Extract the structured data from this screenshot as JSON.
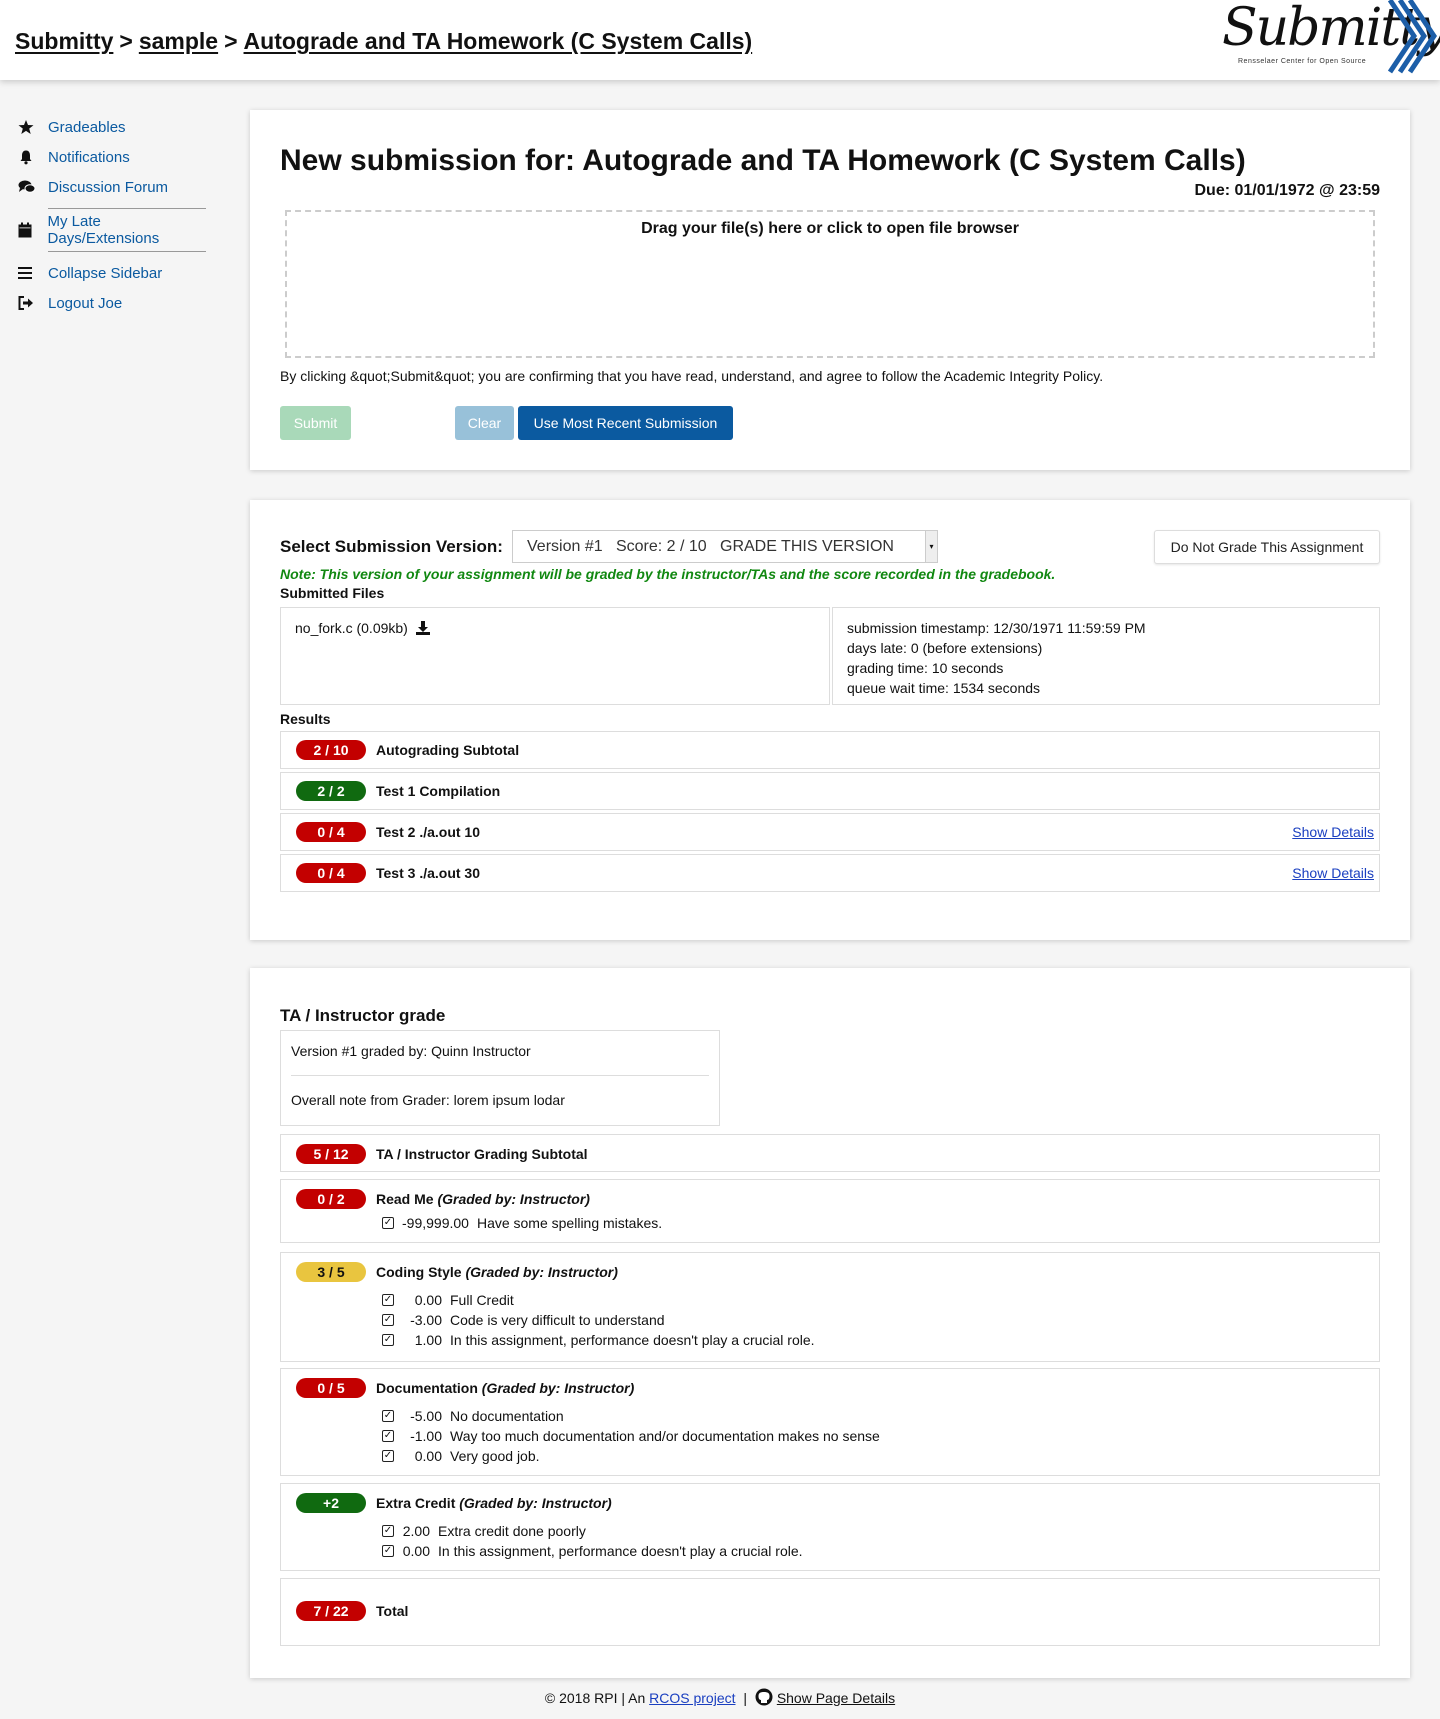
{
  "header": {
    "crumbs": [
      "Submitty",
      "sample",
      "Autograde and TA Homework (C System Calls)"
    ],
    "logo_text": "Submitty",
    "logo_sub": "Rensselaer Center for Open Source"
  },
  "sidebar": {
    "items": [
      {
        "label": "Gradeables",
        "icon": "star-icon"
      },
      {
        "label": "Notifications",
        "icon": "bell-icon"
      },
      {
        "label": "Discussion Forum",
        "icon": "comments-icon"
      },
      {
        "label": "My Late Days/Extensions",
        "icon": "calendar-icon"
      },
      {
        "label": "Collapse Sidebar",
        "icon": "bars-icon"
      },
      {
        "label": "Logout Joe",
        "icon": "logout-icon"
      }
    ]
  },
  "submission": {
    "title": "New submission for: Autograde and TA Homework (C System Calls)",
    "due": "Due: 01/01/1972 @ 23:59",
    "dropzone": "Drag your file(s) here or click to open file browser",
    "integrity": "By clicking &quot;Submit&quot; you are confirming that you have read, understand, and agree to follow the Academic Integrity Policy.",
    "submit_label": "Submit",
    "clear_label": "Clear",
    "recent_label": "Use Most Recent Submission"
  },
  "version": {
    "select_label": "Select Submission Version:",
    "selected": "Version #1   Score: 2 / 10   GRADE THIS VERSION",
    "no_grade_label": "Do Not Grade This Assignment",
    "note": "Note: This version of your assignment will be graded by the instructor/TAs and the score recorded in the gradebook.",
    "files_label": "Submitted Files",
    "file": "no_fork.c (0.09kb)",
    "meta": [
      "submission timestamp: 12/30/1971 11:59:59 PM",
      "days late: 0 (before extensions)",
      "grading time: 10 seconds",
      "queue wait time: 1534 seconds"
    ],
    "results_label": "Results",
    "results": [
      {
        "score": "2 / 10",
        "name": "Autograding Subtotal",
        "color": "red",
        "details": ""
      },
      {
        "score": "2 / 2",
        "name": "Test 1 Compilation",
        "color": "green",
        "details": ""
      },
      {
        "score": "0 / 4",
        "name": "Test 2 ./a.out 10",
        "color": "red",
        "details": "Show Details"
      },
      {
        "score": "0 / 4",
        "name": "Test 3 ./a.out 30",
        "color": "red",
        "details": "Show Details"
      }
    ]
  },
  "ta": {
    "title": "TA / Instructor grade",
    "graded_by": "Version #1 graded by: Quinn Instructor",
    "overall_note": "Overall note from Grader: lorem ipsum lodar",
    "subtotal": {
      "score": "5 / 12",
      "name": "TA / Instructor Grading Subtotal"
    },
    "components": [
      {
        "score": "0 / 2",
        "color": "red",
        "name": "Read Me",
        "by": "(Graded by: Instructor)",
        "marks": [
          {
            "pts": "-99,999.00",
            "text": "Have some spelling mistakes."
          }
        ]
      },
      {
        "score": "3 / 5",
        "color": "yellow",
        "name": "Coding Style",
        "by": "(Graded by: Instructor)",
        "marks": [
          {
            "pts": "0.00",
            "text": "Full Credit"
          },
          {
            "pts": "-3.00",
            "text": "Code is very difficult to understand"
          },
          {
            "pts": "1.00",
            "text": "In this assignment, performance doesn't play a crucial role."
          }
        ]
      },
      {
        "score": "0 / 5",
        "color": "red",
        "name": "Documentation",
        "by": "(Graded by: Instructor)",
        "marks": [
          {
            "pts": "-5.00",
            "text": "No documentation"
          },
          {
            "pts": "-1.00",
            "text": "Way too much documentation and/or documentation makes no sense"
          },
          {
            "pts": "0.00",
            "text": "Very good job."
          }
        ]
      },
      {
        "score": "+2",
        "color": "green",
        "name": "Extra Credit",
        "by": "(Graded by: Instructor)",
        "marks": [
          {
            "pts": "2.00",
            "text": "Extra credit done poorly"
          },
          {
            "pts": "0.00",
            "text": "In this assignment, performance doesn't play a crucial role."
          }
        ]
      }
    ],
    "total": {
      "score": "7 / 22",
      "name": "Total"
    }
  },
  "footer": {
    "copyright": "© 2018 RPI | An",
    "rcos": "RCOS project",
    "sep": "|",
    "details": "Show Page Details"
  },
  "colors": {
    "primary": "#0b5aa0",
    "red": "#c30000",
    "green": "#106a10",
    "yellow": "#e9c53f",
    "note": "#118811"
  }
}
